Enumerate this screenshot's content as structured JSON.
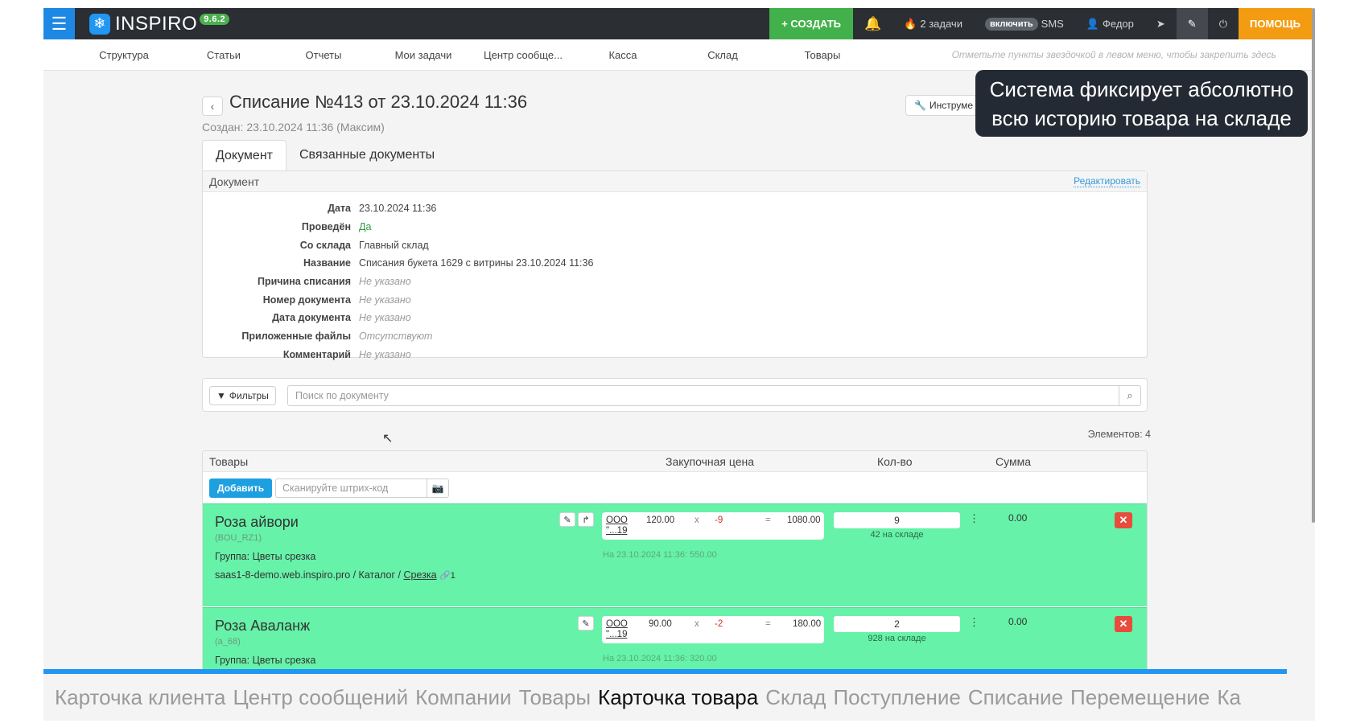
{
  "topbar": {
    "logo_text": "INSPIRO",
    "version": "9.6.2",
    "create_label": "+ СОЗДАТЬ",
    "tasks_label": "2 задачи",
    "sms_toggle": "включить",
    "sms_label": "SMS",
    "user_label": "Федор",
    "help_label": "ПОМОЩЬ"
  },
  "nav": {
    "items": [
      "Структура",
      "Статьи",
      "Отчеты",
      "Мои задачи",
      "Центр сообще...",
      "Касса",
      "Склад",
      "Товары"
    ],
    "hint": "Отметьте пункты звездочкой в левом меню, чтобы закрепить здесь"
  },
  "page": {
    "title": "Списание №413 от 23.10.2024 11:36",
    "subtitle": "Создан: 23.10.2024 11:36 (Максим)",
    "tools_label": "Инструме",
    "tooltip": "Система фиксирует абсолютно всю историю товара на складе"
  },
  "tabs": [
    "Документ",
    "Связанные документы"
  ],
  "document": {
    "header": "Документ",
    "edit_label": "Редактировать",
    "fields": [
      {
        "label": "Дата",
        "value": "23.10.2024 11:36",
        "style": "normal"
      },
      {
        "label": "Проведён",
        "value": "Да",
        "style": "green"
      },
      {
        "label": "Со склада",
        "value": "Главный склад",
        "style": "normal"
      },
      {
        "label": "Название",
        "value": "Списания букета 1629 с витрины 23.10.2024 11:36",
        "style": "normal"
      },
      {
        "label": "Причина списания",
        "value": "Не указано",
        "style": "muted"
      },
      {
        "label": "Номер документа",
        "value": "Не указано",
        "style": "muted"
      },
      {
        "label": "Дата документа",
        "value": "Не указано",
        "style": "muted"
      },
      {
        "label": "Приложенные файлы",
        "value": "Отсутствуют",
        "style": "muted"
      },
      {
        "label": "Комментарий",
        "value": "Не указано",
        "style": "muted"
      }
    ]
  },
  "filter": {
    "filters_label": "Фильтры",
    "search_placeholder": "Поиск по документу",
    "count_label": "Элементов: 4"
  },
  "products": {
    "columns": {
      "goods": "Товары",
      "price": "Закупочная цена",
      "qty": "Кол-во",
      "sum": "Сумма"
    },
    "add_label": "Добавить",
    "scan_placeholder": "Сканируйте штрих-код",
    "rows": [
      {
        "name": "Роза айвори",
        "sku": "(BOU_RZ1)",
        "group": "Группа: Цветы срезка",
        "path_prefix": "saas1-8-demo.web.inspiro.pro / Каталог /",
        "path_link": "Срезка",
        "path_count": "1",
        "supplier_line1": "ООО",
        "supplier_line2": "\"...19",
        "price": "120.00",
        "times": "x",
        "multiplier": "-9",
        "equals": "=",
        "total": "1080.00",
        "price_date": "На 23.10.2024 11:36: 550.00",
        "qty": "9",
        "stock": "42 на складе",
        "sum": "0.00"
      },
      {
        "name": "Роза Аваланж",
        "sku": "(a_68)",
        "group": "Группа: Цветы срезка",
        "supplier_line1": "ООО",
        "supplier_line2": "\"...19",
        "price": "90.00",
        "times": "x",
        "multiplier": "-2",
        "equals": "=",
        "total": "180.00",
        "price_date": "На 23.10.2024 11:36: 320.00",
        "qty": "2",
        "stock": "928 на складе",
        "sum": "0.00"
      }
    ]
  },
  "caption": {
    "items": [
      "Карточка клиента",
      "Центр сообщений",
      "Компании",
      "Товары",
      "Карточка товара",
      "Склад",
      "Поступление",
      "Списание",
      "Перемещение",
      "Ка"
    ],
    "current_index": 4
  },
  "colors": {
    "accent": "#1e88e5",
    "create": "#43b14b",
    "help": "#f39c12",
    "row_highlight": "#66f2a8",
    "delete": "#e74c3c"
  }
}
